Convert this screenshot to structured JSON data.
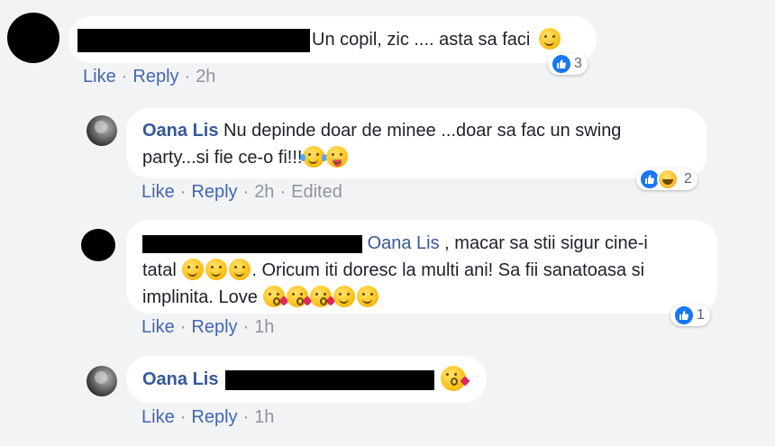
{
  "comments": [
    {
      "text": "Un copil, zic .... asta sa faci",
      "reaction_count": "3",
      "like_label": "Like",
      "reply_label": "Reply",
      "time": "2h"
    },
    {
      "author": "Oana Lis",
      "text_line1": "Nu depinde doar de minee ...doar sa fac un swing",
      "text_line2": "party...si fie ce-o fi!!!",
      "reaction_count": "2",
      "like_label": "Like",
      "reply_label": "Reply",
      "time": "2h",
      "edited": "Edited"
    },
    {
      "mention": "Oana Lis",
      "text_line1": " , macar sa stii sigur cine-i",
      "text_line2a": "tatal",
      "text_line2b": ". Oricum iti doresc la multi ani! Sa fii sanatoasa si",
      "text_line3": "implinita. Love",
      "reaction_count": "1",
      "like_label": "Like",
      "reply_label": "Reply",
      "time": "1h"
    },
    {
      "author": "Oana Lis",
      "like_label": "Like",
      "reply_label": "Reply",
      "time": "1h"
    }
  ],
  "colors": {
    "link": "#4267b2",
    "author": "#365899",
    "like_blue": "#1877f2",
    "background": "#f2f3f5"
  }
}
